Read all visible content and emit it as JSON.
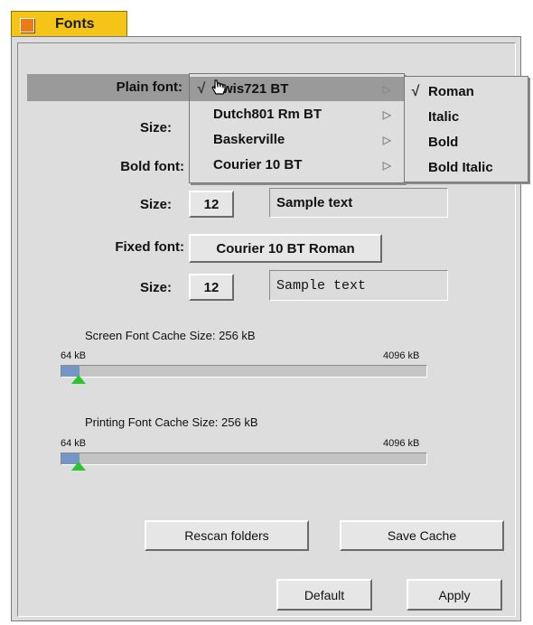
{
  "window": {
    "title": "Fonts"
  },
  "plain_font": {
    "label": "Plain font:",
    "value": "Swis721 BT"
  },
  "plain_size": {
    "label": "Size:"
  },
  "bold_font": {
    "label": "Bold font:"
  },
  "bold_size": {
    "label": "Size:",
    "value": "12",
    "sample": "Sample text"
  },
  "fixed_font": {
    "label": "Fixed font:",
    "value": "Courier 10 BT Roman"
  },
  "fixed_size": {
    "label": "Size:",
    "value": "12",
    "sample": "Sample text"
  },
  "font_menu": {
    "items": [
      {
        "label": "Swis721 BT",
        "checked": true,
        "selected": true
      },
      {
        "label": "Dutch801 Rm BT",
        "checked": false,
        "selected": false
      },
      {
        "label": "Baskerville",
        "checked": false,
        "selected": false
      },
      {
        "label": "Courier 10 BT",
        "checked": false,
        "selected": false
      }
    ],
    "check_glyph": "√",
    "arrow_glyph": "▷"
  },
  "style_menu": {
    "items": [
      {
        "label": "Roman",
        "checked": true
      },
      {
        "label": "Italic",
        "checked": false
      },
      {
        "label": "Bold",
        "checked": false
      },
      {
        "label": "Bold Italic",
        "checked": false
      }
    ]
  },
  "screen_cache": {
    "label": "Screen Font Cache Size:  256 kB",
    "min": "64 kB",
    "max": "4096 kB",
    "fraction": 0.05
  },
  "print_cache": {
    "label": "Printing Font Cache Size:  256 kB",
    "min": "64 kB",
    "max": "4096 kB",
    "fraction": 0.05
  },
  "buttons": {
    "rescan": "Rescan folders",
    "save_cache": "Save Cache",
    "default": "Default",
    "apply": "Apply"
  },
  "colors": {
    "tab": "#f4c516",
    "accent_fill": "#7396c4",
    "thumb": "#29c431"
  }
}
